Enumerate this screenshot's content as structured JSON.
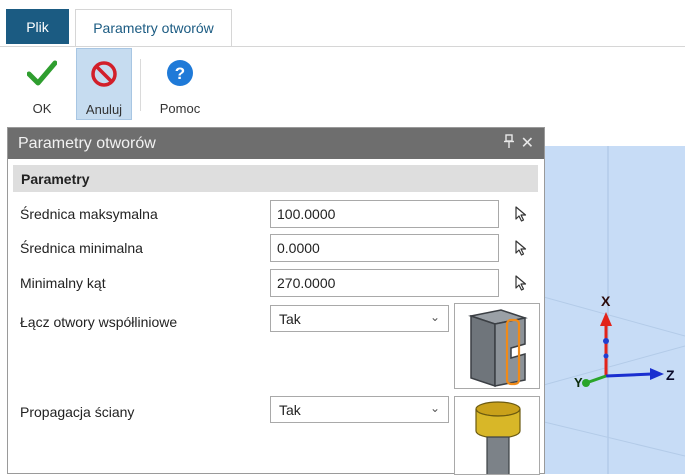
{
  "ribbon_tabs": {
    "file": "Plik",
    "active": "Parametry otworów"
  },
  "ribbon_buttons": {
    "ok": "OK",
    "cancel": "Anuluj",
    "help": "Pomoc"
  },
  "panel": {
    "title": "Parametry otworów",
    "pin_glyph": "📌",
    "close_glyph": "✕",
    "section": "Parametry",
    "fields": [
      {
        "label": "Średnica maksymalna",
        "value": "100.0000"
      },
      {
        "label": "Średnica minimalna",
        "value": "0.0000"
      },
      {
        "label": "Minimalny kąt",
        "value": "270.0000"
      }
    ],
    "selects": [
      {
        "label": "Łącz otwory współliniowe",
        "value": "Tak"
      },
      {
        "label": "Propagacja ściany",
        "value": "Tak"
      }
    ]
  },
  "viewport": {
    "axes": {
      "x": "X",
      "y": "Y",
      "z": "Z"
    },
    "background": "#c7dcf6"
  },
  "colors": {
    "accent": "#1b5b82",
    "ok": "#2f9e2f",
    "cancel": "#d21f2a",
    "help": "#1f7ad8"
  }
}
